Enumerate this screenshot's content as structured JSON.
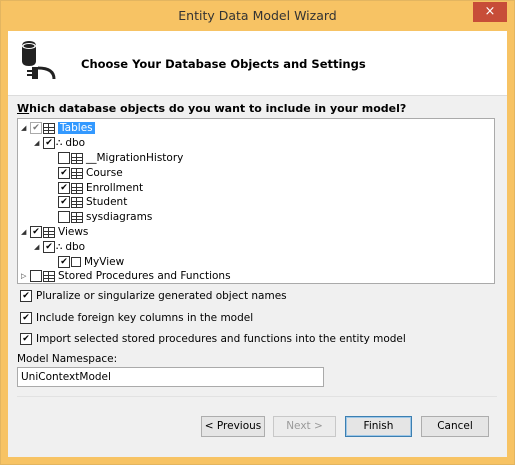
{
  "window": {
    "title": "Entity Data Model Wizard",
    "close_glyph": "×"
  },
  "header": {
    "title": "Choose Your Database Objects and Settings"
  },
  "question": {
    "prefix": "W",
    "rest": "hich database objects do you want to include in your model?"
  },
  "tree": {
    "tables": {
      "label": "Tables",
      "checked": true
    },
    "tables_dbo": {
      "label": "dbo",
      "checked": true
    },
    "table_items": [
      {
        "label": "__MigrationHistory",
        "checked": false
      },
      {
        "label": "Course",
        "checked": true
      },
      {
        "label": "Enrollment",
        "checked": true
      },
      {
        "label": "Student",
        "checked": true
      },
      {
        "label": "sysdiagrams",
        "checked": false
      }
    ],
    "views": {
      "label": "Views",
      "checked": true
    },
    "views_dbo": {
      "label": "dbo",
      "checked": true
    },
    "view_items": [
      {
        "label": "MyView",
        "checked": true
      }
    ],
    "procs": {
      "label": "Stored Procedures and Functions",
      "checked": false
    }
  },
  "options": {
    "pluralize": {
      "label": "Pluralize or singularize generated object names",
      "checked": true
    },
    "foreign_keys": {
      "label": "Include foreign key columns in the model",
      "checked": true
    },
    "import_procs": {
      "label": "Import selected stored procedures and functions into the entity model",
      "checked": true
    }
  },
  "namespace": {
    "label": "Model Namespace:",
    "value": "UniContextModel"
  },
  "buttons": {
    "previous": "< Previous",
    "next": "Next >",
    "finish": "Finish",
    "cancel": "Cancel"
  }
}
